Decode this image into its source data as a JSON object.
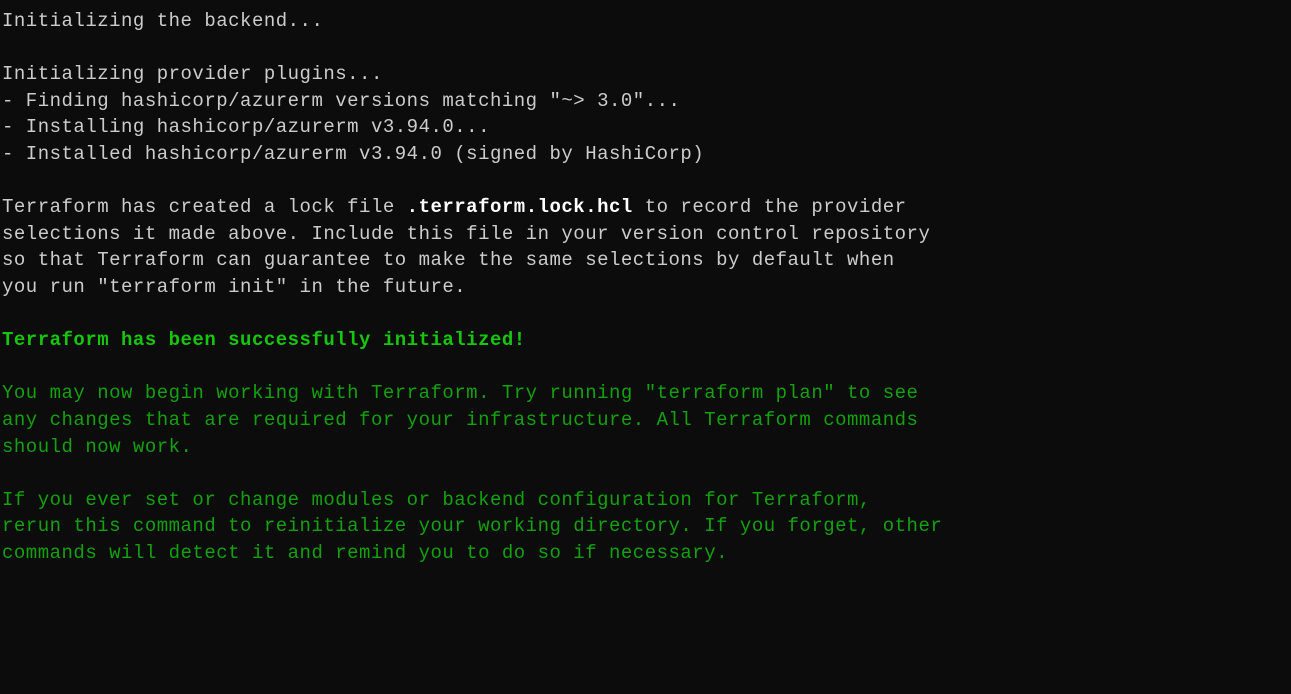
{
  "terminal": {
    "lines": {
      "l0": "Initializing the backend...",
      "l1": "Initializing provider plugins...",
      "l2": "- Finding hashicorp/azurerm versions matching \"~> 3.0\"...",
      "l3": "- Installing hashicorp/azurerm v3.94.0...",
      "l4": "- Installed hashicorp/azurerm v3.94.0 (signed by HashiCorp)",
      "l5a": "Terraform has created a lock file ",
      "l5b": ".terraform.lock.hcl",
      "l5c": " to record the provider",
      "l6": "selections it made above. Include this file in your version control repository",
      "l7": "so that Terraform can guarantee to make the same selections by default when",
      "l8": "you run \"terraform init\" in the future.",
      "l9": "Terraform has been successfully initialized!",
      "l10": "You may now begin working with Terraform. Try running \"terraform plan\" to see",
      "l11": "any changes that are required for your infrastructure. All Terraform commands",
      "l12": "should now work.",
      "l13": "If you ever set or change modules or backend configuration for Terraform,",
      "l14": "rerun this command to reinitialize your working directory. If you forget, other",
      "l15": "commands will detect it and remind you to do so if necessary."
    }
  }
}
